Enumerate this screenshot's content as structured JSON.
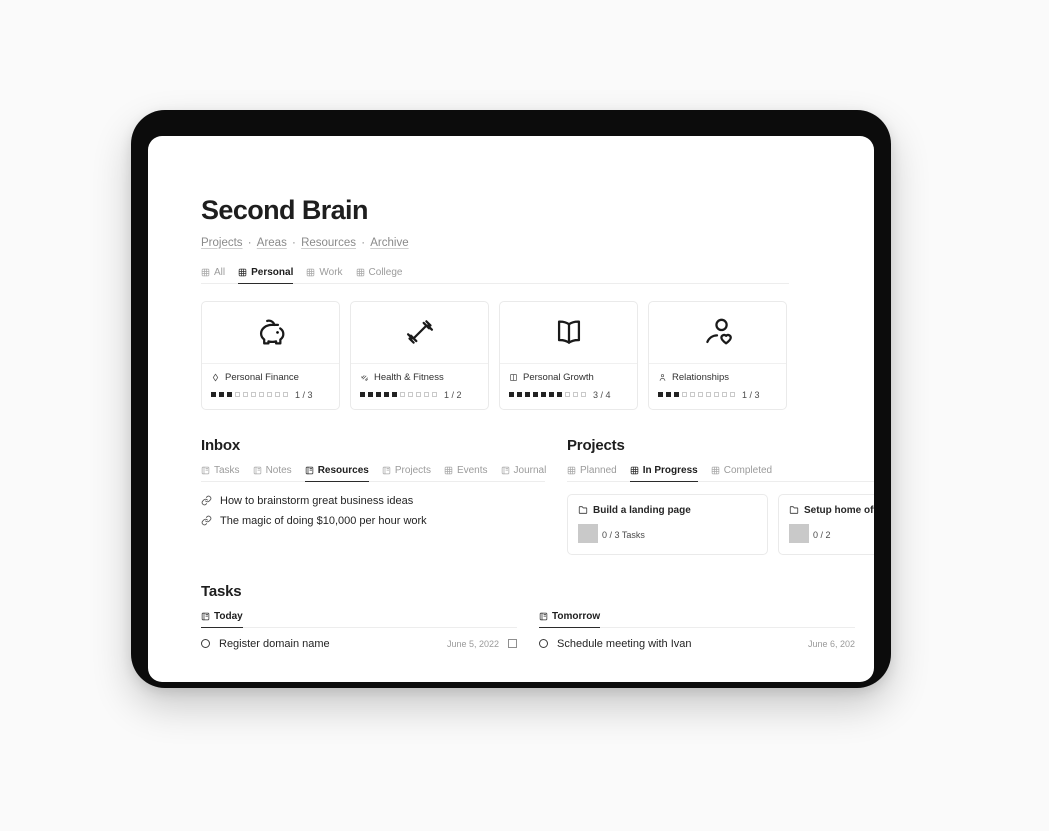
{
  "page": {
    "title": "Second Brain",
    "breadcrumb": [
      "Projects",
      "Areas",
      "Resources",
      "Archive"
    ],
    "breadcrumb_separator": "·"
  },
  "type_tabs": [
    {
      "label": "All",
      "icon": "table-icon",
      "active": false
    },
    {
      "label": "Personal",
      "icon": "table-icon",
      "active": true
    },
    {
      "label": "Work",
      "icon": "table-icon",
      "active": false
    },
    {
      "label": "College",
      "icon": "table-icon",
      "active": false
    }
  ],
  "categories": [
    {
      "name": "Personal Finance",
      "art_icon": "piggy-bank-icon",
      "name_icon": "diamond-icon",
      "filled": 3,
      "total": 10,
      "ratio": "1 / 3"
    },
    {
      "name": "Health & Fitness",
      "art_icon": "dumbbell-icon",
      "name_icon": "dumbbell-small-icon",
      "filled": 5,
      "total": 10,
      "ratio": "1 / 2"
    },
    {
      "name": "Personal Growth",
      "art_icon": "open-book-icon",
      "name_icon": "book-small-icon",
      "filled": 7,
      "total": 10,
      "ratio": "3 / 4"
    },
    {
      "name": "Relationships",
      "art_icon": "person-heart-icon",
      "name_icon": "person-small-icon",
      "filled": 3,
      "total": 10,
      "ratio": "1 / 3"
    }
  ],
  "inbox": {
    "title": "Inbox",
    "tabs": [
      {
        "label": "Tasks",
        "icon": "board-icon",
        "active": false
      },
      {
        "label": "Notes",
        "icon": "board-icon",
        "active": false
      },
      {
        "label": "Resources",
        "icon": "board-icon",
        "active": true
      },
      {
        "label": "Projects",
        "icon": "board-icon",
        "active": false
      },
      {
        "label": "Events",
        "icon": "table-icon",
        "active": false
      },
      {
        "label": "Journal",
        "icon": "board-icon",
        "active": false
      }
    ],
    "items": [
      {
        "icon": "link-icon",
        "label": "How to brainstorm great business ideas"
      },
      {
        "icon": "link-icon",
        "label": "The magic of doing $10,000 per hour work"
      }
    ]
  },
  "projects": {
    "title": "Projects",
    "tabs": [
      {
        "label": "Planned",
        "icon": "table-icon",
        "active": false
      },
      {
        "label": "In Progress",
        "icon": "table-icon",
        "active": true
      },
      {
        "label": "Completed",
        "icon": "table-icon",
        "active": false
      }
    ],
    "cards": [
      {
        "name": "Build a landing page",
        "icon": "folder-icon",
        "filled": 0,
        "total": 10,
        "ratio": "0 / 3 Tasks"
      },
      {
        "name": "Setup home office",
        "icon": "folder-icon",
        "filled": 0,
        "total": 10,
        "ratio": "0 / 2"
      }
    ]
  },
  "tasks": {
    "title": "Tasks",
    "columns": [
      {
        "tab_label": "Today",
        "tab_icon": "board-icon",
        "rows": [
          {
            "status_icon": "circle-icon",
            "name": "Register domain name",
            "date": "June 5, 2022",
            "has_checkbox": true
          }
        ]
      },
      {
        "tab_label": "Tomorrow",
        "tab_icon": "board-icon",
        "rows": [
          {
            "status_icon": "circle-icon",
            "name": "Schedule meeting with Ivan",
            "date": "June 6, 202",
            "has_checkbox": false
          }
        ]
      }
    ]
  },
  "colors": {
    "background": "#fafafa",
    "device_bezel": "#0c0c0c",
    "screen": "#ffffff",
    "text_primary": "#1e1e1e",
    "text_muted": "#9b9b9b",
    "border": "#eaeaea",
    "pip_on": "#222222"
  }
}
